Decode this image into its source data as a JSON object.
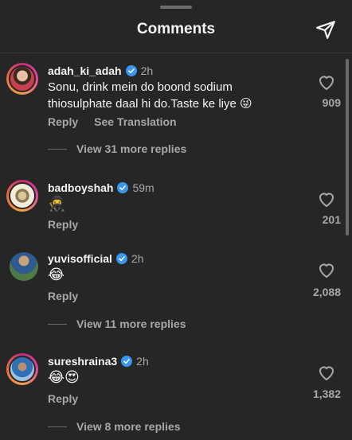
{
  "header": {
    "title": "Comments",
    "send_icon": "send-icon"
  },
  "comments": [
    {
      "username": "adah_ki_adah",
      "time": "2h",
      "verified": true,
      "text_line1": "Sonu, drink mein do boond sodium",
      "text_line2": "thiosulphate daal hi do.Taste ke liye 😜",
      "reply_label": "Reply",
      "translate_label": "See Translation",
      "likes": "909",
      "view_replies": "View 31 more replies",
      "avatar_story_ring": true
    },
    {
      "username": "badboyshah",
      "time": "59m",
      "verified": true,
      "text": "🥷",
      "reply_label": "Reply",
      "likes": "201",
      "avatar_story_ring": true
    },
    {
      "username": "yuvisofficial",
      "time": "2h",
      "verified": true,
      "text": "😂",
      "reply_label": "Reply",
      "likes": "2,088",
      "view_replies": "View 11 more replies",
      "avatar_story_ring": false
    },
    {
      "username": "sureshraina3",
      "time": "2h",
      "verified": true,
      "text": "😂😍",
      "reply_label": "Reply",
      "likes": "1,382",
      "view_replies": "View 8 more replies",
      "avatar_story_ring": true
    }
  ],
  "colors": {
    "background": "#262626",
    "secondary_text": "#a8a8a8",
    "verified_blue": "#3897f0",
    "story_ring_start": "#c62a7a",
    "story_ring_end": "#f7a24a"
  }
}
